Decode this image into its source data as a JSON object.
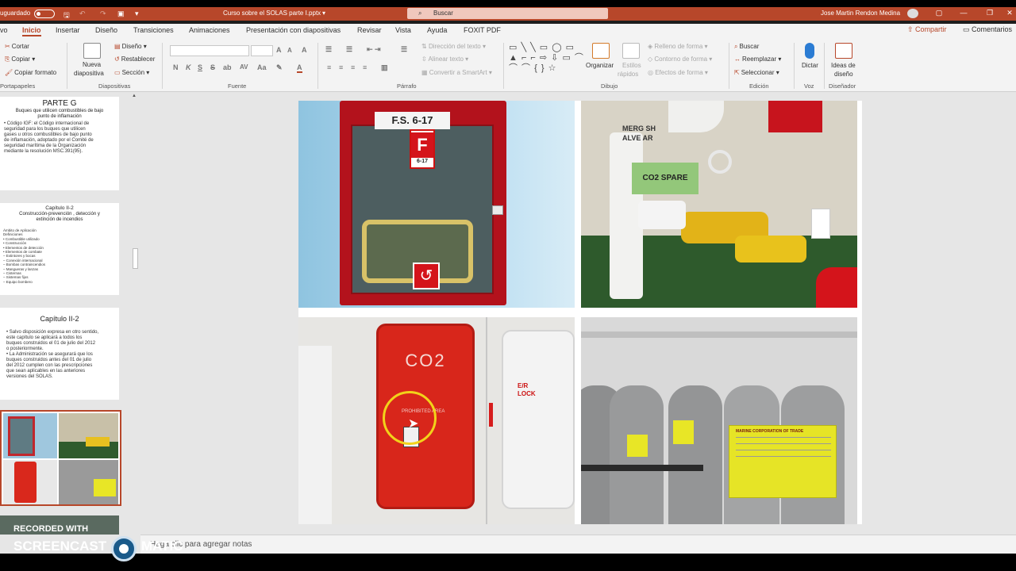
{
  "title_bar": {
    "autosave_label": "uguardado",
    "file_name": "Curso sobre el SOLAS parte I.pptx",
    "file_chevron": "▾",
    "search_placeholder": "Buscar",
    "search_glyph": "⌕",
    "user_name": "Jose Martin Rendon Medina",
    "quick_access": [
      "🖫",
      "↶",
      "↷",
      "▣",
      "▾"
    ],
    "window_buttons": [
      "▢",
      "—",
      "❐",
      "✕"
    ]
  },
  "tabs": [
    "vo",
    "Inicio",
    "Insertar",
    "Diseño",
    "Transiciones",
    "Animaciones",
    "Presentación con diapositivas",
    "Revisar",
    "Vista",
    "Ayuda",
    "FOXIT PDF"
  ],
  "share_label": "Compartir",
  "comments_label": "Comentarios",
  "ribbon": {
    "clipboard": {
      "cut": "Cortar",
      "copy": "Copiar",
      "format": "Copiar formato",
      "group": "Portapapeles",
      "cut_icon": "✂",
      "copy_icon": "⎘",
      "format_icon": "🖌"
    },
    "slides": {
      "new_line1": "Nueva",
      "new_line2": "diapositiva",
      "layout": "Diseño",
      "reset": "Restablecer",
      "section": "Sección",
      "group": "Diapositivas",
      "layout_icon": "▤",
      "reset_icon": "↺",
      "section_icon": "▭"
    },
    "font": {
      "group": "Fuente",
      "size_up": "A",
      "size_down": "A",
      "clear": "A",
      "bold": "N",
      "italic": "K",
      "underline": "S",
      "strike": "S",
      "shadow": "ab",
      "spacing": "AV",
      "case": "Aa",
      "highlight": "✎",
      "color": "A"
    },
    "paragraph": {
      "group": "Párrafo",
      "direction": "Dirección del texto",
      "align": "Alinear texto",
      "smartart": "Convertir a SmartArt",
      "bullets": "☰",
      "numbering": "☰",
      "indent": "⇤ ⇥",
      "line_spacing": "☰",
      "columns": "▥",
      "align_left": "≡",
      "align_center": "≡",
      "align_right": "≡",
      "justify": "≡"
    },
    "drawing": {
      "group": "Dibujo",
      "arrange": "Organizar",
      "quick_line1": "Estilos",
      "quick_line2": "rápidos",
      "fill": "Relleno de forma",
      "outline": "Contorno de forma",
      "effects": "Efectos de forma",
      "shapes": "▭ ╲ ╲ ▭ ◯ ▭ ▲ ⌐ ⌐ ⇨ ⇩ ▭ ⌒ ⌒ ⌒ { } ☆"
    },
    "editing": {
      "group": "Edición",
      "find": "Buscar",
      "replace": "Reemplazar",
      "select": "Seleccionar",
      "find_icon": "⌕",
      "replace_icon": "↔",
      "select_icon": "⇱"
    },
    "voice": {
      "group": "Voz",
      "dictate": "Dictar"
    },
    "designer": {
      "group": "Diseñador",
      "ideas_line1": "Ideas de",
      "ideas_line2": "diseño"
    }
  },
  "thumbnails": {
    "t1": {
      "title": "PARTE G",
      "subtitle_l1": "Buques que utilicen combustibles de bajo",
      "subtitle_l2": "punto de inflamación",
      "body": [
        "• Código IGF: el Código internacional de",
        "seguridad para los buques que utilicen",
        "gases u otros combustibles de bajo punto",
        "de inflamación, adoptado por el Comité de",
        "seguridad marítima de la Organización",
        "mediante la resolución MSC.391(95)."
      ]
    },
    "t2": {
      "title": "Capítulo II-2",
      "subtitle_l1": "Construcción-prevención , detección y",
      "subtitle_l2": "extinción de incendios",
      "body": [
        "Ámbito de Aplicación",
        "Definiciones",
        "•  Combustible utilizado",
        "•  Construcción",
        "•  Elementos de detección",
        "•  Elementos de combate",
        "      – Extintores y bocas",
        "      – Conexión internacional",
        "      – Bombas contraincendios",
        "      – Mangueras y lanzas",
        "      – Cisternas",
        "      – Sistemas fijos",
        "      – Equipo bombero"
      ]
    },
    "t3": {
      "title": "Capítulo II-2",
      "body": [
        "• Salvo disposición expresa en otro sentido,",
        "   este capítulo se aplicará a todos los",
        "   buques construidos el 01 de julio del 2012",
        "   o posteriormente.",
        "• La Administración se asegurará que los",
        "   buques construidos antes del 01 de julio",
        "   del 2012 cumplen con las prescripciones",
        "   que sean aplicables en las anteriores",
        "   versiones del SOLAS."
      ]
    }
  },
  "slide": {
    "photo1": {
      "sign_top": "F.S. 6-17",
      "sign_letter": "F",
      "sign_sub": "6-17"
    },
    "photo2": {
      "label_co2": "CO2 SPARE",
      "wall_text": "MERG SH",
      "wall_text2": "ALVE AR"
    },
    "photo3": {
      "door_label": "CO2",
      "lock_label1": "E/R",
      "lock_label2": "LOCK",
      "small_text": "PROHIBITED AREA"
    },
    "photo4": {
      "tag_text": "MARINE CORPORATION OF TRADE"
    }
  },
  "notes_placeholder": "Haga clic para agregar notas",
  "watermark": {
    "line1": "RECORDED WITH",
    "line2": "SCREENCAST",
    "line3": "MATIC"
  }
}
